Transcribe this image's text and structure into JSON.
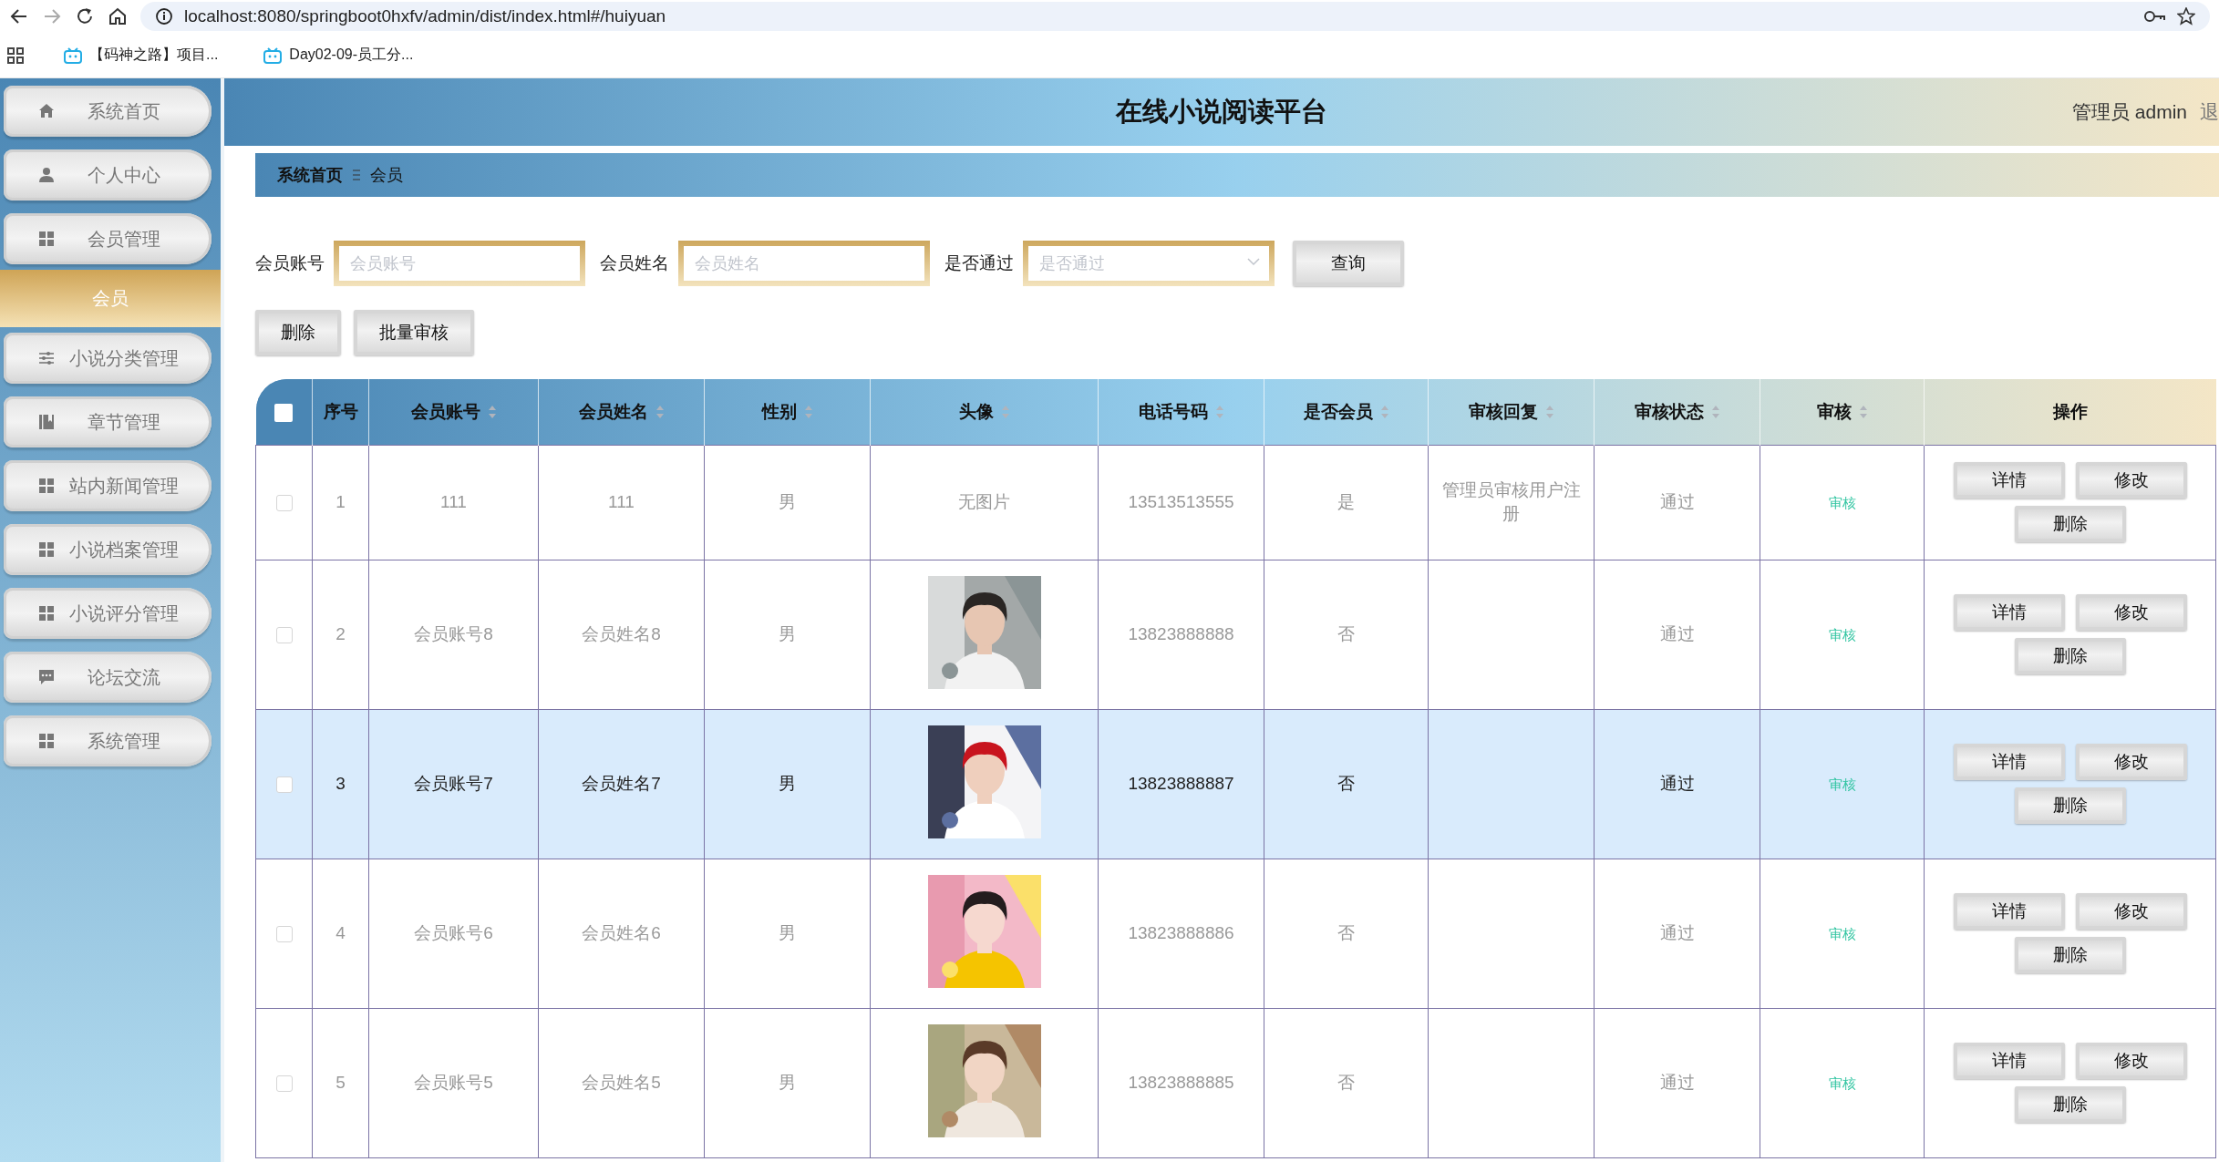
{
  "browser": {
    "url": "localhost:8080/springboot0hxfv/admin/dist/index.html#/huiyuan",
    "bookmarks": [
      {
        "label": "【码神之路】项目..."
      },
      {
        "label": "Day02-09-员工分..."
      }
    ]
  },
  "sidebar": {
    "items": [
      {
        "label": "系统首页",
        "selected": false
      },
      {
        "label": "个人中心",
        "selected": false
      },
      {
        "label": "会员管理",
        "selected": false,
        "children": [
          {
            "label": "会员",
            "selected": true
          }
        ]
      },
      {
        "label": "小说分类管理",
        "selected": false
      },
      {
        "label": "章节管理",
        "selected": false
      },
      {
        "label": "站内新闻管理",
        "selected": false
      },
      {
        "label": "小说档案管理",
        "selected": false
      },
      {
        "label": "小说评分管理",
        "selected": false
      },
      {
        "label": "论坛交流",
        "selected": false
      },
      {
        "label": "系统管理",
        "selected": false
      }
    ]
  },
  "header": {
    "title": "在线小说阅读平台",
    "user": "管理员 admin",
    "logout": "退"
  },
  "breadcrumb": [
    {
      "label": "系统首页"
    },
    {
      "label": "会员"
    }
  ],
  "search": {
    "fields": [
      {
        "label": "会员账号",
        "placeholder": "会员账号",
        "kind": "input"
      },
      {
        "label": "会员姓名",
        "placeholder": "会员姓名",
        "kind": "input"
      },
      {
        "label": "是否通过",
        "placeholder": "是否通过",
        "kind": "select"
      }
    ],
    "button": "查询"
  },
  "actions": [
    "删除",
    "批量审核"
  ],
  "table": {
    "select_all": {
      "checked": false
    },
    "columns": [
      {
        "label": "序号"
      },
      {
        "label": "会员账号",
        "sortable": true
      },
      {
        "label": "会员姓名",
        "sortable": true
      },
      {
        "label": "性别",
        "sortable": true
      },
      {
        "label": "头像",
        "sortable": true
      },
      {
        "label": "电话号码",
        "sortable": true
      },
      {
        "label": "是否会员",
        "sortable": true
      },
      {
        "label": "审核回复",
        "sortable": true
      },
      {
        "label": "审核状态",
        "sortable": true
      },
      {
        "label": "审核",
        "sortable": true
      },
      {
        "label": "操作"
      }
    ],
    "rows": [
      {
        "checked": false,
        "highlighted": false,
        "index": "1",
        "account": "111",
        "name": "111",
        "gender": "男",
        "avatar": {
          "kind": "text",
          "text": "无图片"
        },
        "phone": "13513513555",
        "member": "是",
        "reply": "管理员审核用户注册",
        "status": "通过",
        "review": "审核",
        "buttons": [
          "详情",
          "修改",
          "删除"
        ]
      },
      {
        "checked": false,
        "highlighted": false,
        "index": "2",
        "account": "会员账号8",
        "name": "会员姓名8",
        "gender": "男",
        "phone": "13823888888",
        "member": "否",
        "status": "通过",
        "review": "审核",
        "buttons": [
          "详情",
          "修改",
          "删除"
        ]
      },
      {
        "checked": false,
        "highlighted": true,
        "index": "3",
        "account": "会员账号7",
        "name": "会员姓名7",
        "gender": "男",
        "phone": "13823888887",
        "member": "否",
        "status": "通过",
        "review": "审核",
        "buttons": [
          "详情",
          "修改",
          "删除"
        ]
      },
      {
        "checked": false,
        "highlighted": false,
        "index": "4",
        "account": "会员账号6",
        "name": "会员姓名6",
        "gender": "男",
        "phone": "13823888886",
        "member": "否",
        "status": "通过",
        "review": "审核",
        "buttons": [
          "详情",
          "修改",
          "删除"
        ]
      },
      {
        "checked": false,
        "highlighted": false,
        "index": "5",
        "account": "会员账号5",
        "name": "会员姓名5",
        "gender": "男",
        "phone": "13823888885",
        "member": "否",
        "status": "通过",
        "review": "审核",
        "buttons": [
          "详情",
          "修改",
          "删除"
        ]
      }
    ]
  }
}
